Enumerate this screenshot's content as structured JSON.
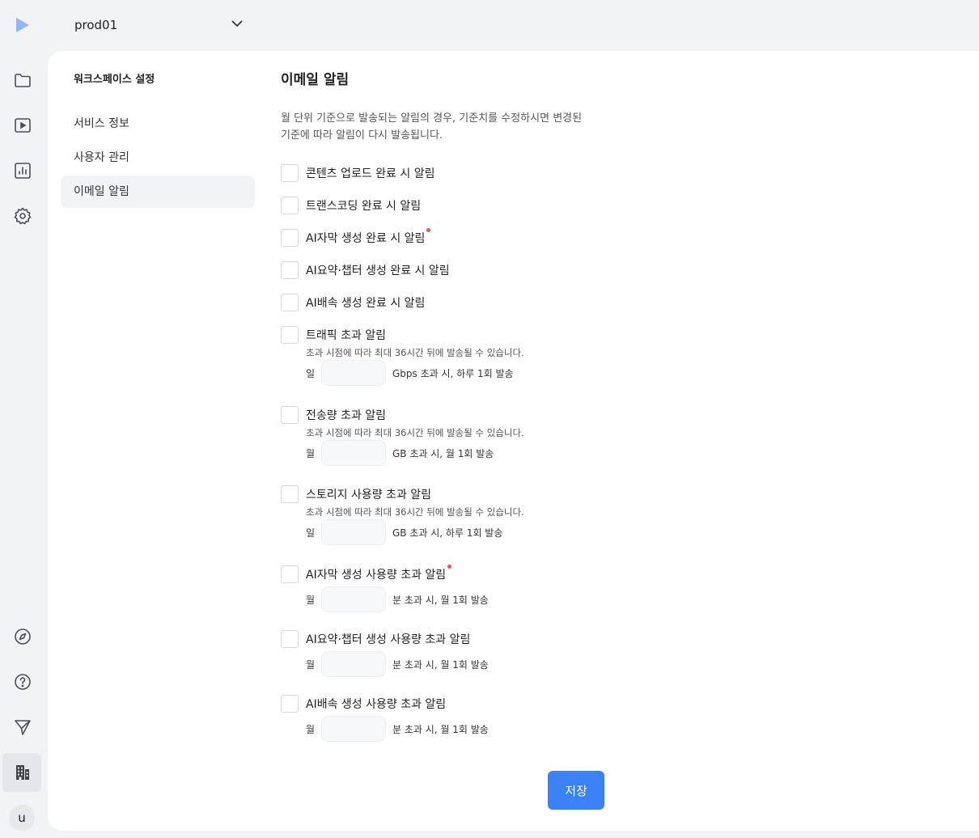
{
  "header": {
    "workspace_name": "prod01"
  },
  "user": {
    "avatar_initial": "u"
  },
  "rail": {
    "icons": [
      "play-logo-icon",
      "folder-icon",
      "video-icon",
      "analytics-icon",
      "settings-icon",
      "compass-icon",
      "help-icon",
      "send-icon",
      "building-icon"
    ]
  },
  "subnav": {
    "title": "워크스페이스 설정",
    "items": [
      {
        "label": "서비스 정보",
        "active": false
      },
      {
        "label": "사용자 관리",
        "active": false
      },
      {
        "label": "이메일 알림",
        "active": true
      }
    ]
  },
  "main": {
    "title": "이메일 알림",
    "description": "월 단위 기준으로 발송되는 알림의 경우, 기준치를 수정하시면 변경된 기준에 따라 알림이 다시 발송됩니다.",
    "options": [
      {
        "label": "콘텐츠 업로드 완료 시 알림",
        "checked": false
      },
      {
        "label": "트랜스코딩 완료 시 알림",
        "checked": false
      },
      {
        "label": "AI자막 생성 완료 시 알림",
        "checked": false,
        "new": true
      },
      {
        "label": "AI요약·챕터 생성 완료 시 알림",
        "checked": false
      },
      {
        "label": "AI배속 생성 완료 시 알림",
        "checked": false
      },
      {
        "label": "트래픽 초과 알림",
        "checked": false,
        "hint": "초과 시점에 따라 최대 36시간 뒤에 발송될 수 있습니다.",
        "period": "일",
        "value": "",
        "unit": "Gbps 초과 시, 하루 1회 발송"
      },
      {
        "label": "전송량 초과 알림",
        "checked": false,
        "hint": "초과 시점에 따라 최대 36시간 뒤에 발송될 수 있습니다.",
        "period": "월",
        "value": "",
        "unit": "GB 초과 시, 월 1회 발송"
      },
      {
        "label": "스토리지 사용량 초과 알림",
        "checked": false,
        "hint": "초과 시점에 따라 최대 36시간 뒤에 발송될 수 있습니다.",
        "period": "일",
        "value": "",
        "unit": "GB 초과 시, 하루 1회 발송"
      },
      {
        "label": "AI자막 생성 사용량 초과 알림",
        "checked": false,
        "new": true,
        "period": "월",
        "value": "",
        "unit": "분 초과 시, 월 1회 발송"
      },
      {
        "label": "AI요약·챕터 생성 사용량 초과 알림",
        "checked": false,
        "period": "월",
        "value": "",
        "unit": "분 초과 시, 월 1회 발송"
      },
      {
        "label": "AI배속 생성 사용량 초과 알림",
        "checked": false,
        "period": "월",
        "value": "",
        "unit": "분 초과 시, 월 1회 발송"
      }
    ],
    "save_label": "저장"
  },
  "colors": {
    "accent": "#3b82f6",
    "logo": "#93b4f5",
    "new_dot": "#f05252"
  }
}
